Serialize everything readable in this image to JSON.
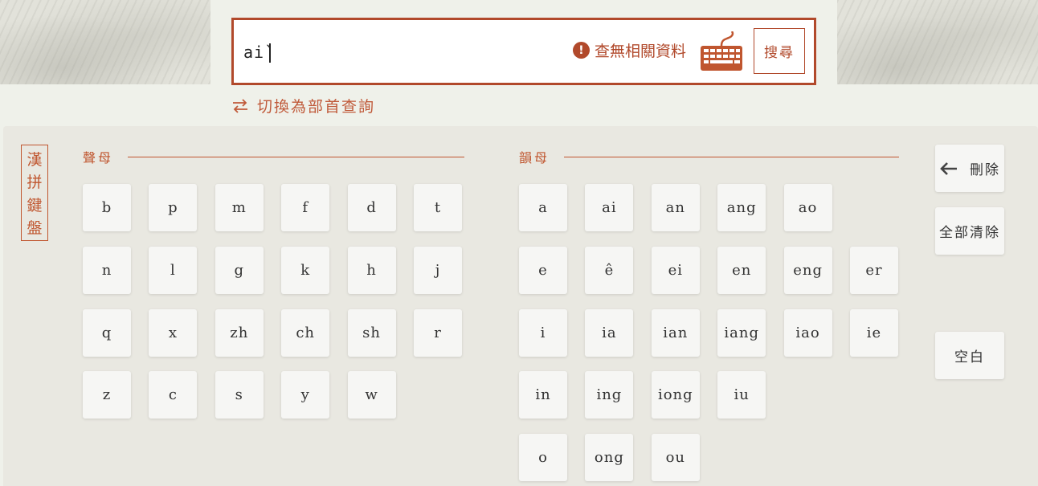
{
  "search": {
    "value": "ai`",
    "error_text": "查無相關資料",
    "keyboard_icon": "keyboard-icon",
    "button_label": "搜尋"
  },
  "switch_link": {
    "label": "切換為部首查詢",
    "icon": "swap-arrows-icon"
  },
  "keyboard": {
    "title_chars": [
      "漢",
      "拼",
      "鍵",
      "盤"
    ],
    "initials": {
      "title": "聲母",
      "rows": [
        [
          "b",
          "p",
          "m",
          "f",
          "d",
          "t"
        ],
        [
          "n",
          "l",
          "g",
          "k",
          "h",
          "j"
        ],
        [
          "q",
          "x",
          "zh",
          "ch",
          "sh",
          "r"
        ],
        [
          "z",
          "c",
          "s",
          "y",
          "w"
        ]
      ]
    },
    "finals": {
      "title": "韻母",
      "rows": [
        [
          "a",
          "ai",
          "an",
          "ang",
          "ao"
        ],
        [
          "e",
          "ê",
          "ei",
          "en",
          "eng",
          "er"
        ],
        [
          "i",
          "ia",
          "ian",
          "iang",
          "iao",
          "ie"
        ],
        [
          "in",
          "ing",
          "iong",
          "iu"
        ],
        [
          "o",
          "ong",
          "ou"
        ]
      ]
    },
    "actions": {
      "delete_label": "刪除",
      "delete_icon": "left-arrow-icon",
      "clear_all_label": "全部清除",
      "space_label": "空白"
    }
  },
  "colors": {
    "accent": "#b1492b",
    "panel": "#e9e8e1",
    "page": "#eff1ea"
  }
}
